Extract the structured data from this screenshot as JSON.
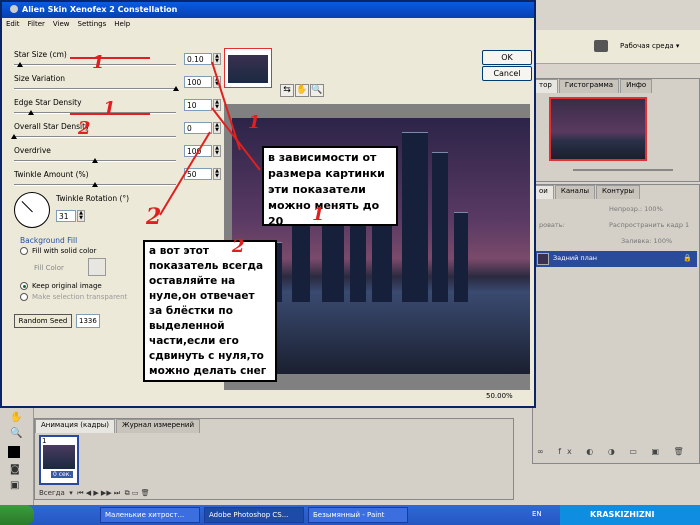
{
  "photoshop": {
    "workspace_label": "Рабочая среда ▾",
    "navigator_tabs": [
      "тор",
      "Гистограмма",
      "Инфо"
    ],
    "layers_tabs": [
      "ои",
      "Каналы",
      "Контуры"
    ],
    "layers_opacity_label": "Непрозр.:",
    "layers_opacity_value": "100%",
    "layers_propagate_label": "Распространить кадр 1",
    "layers_fill_label": "Заливка:",
    "layers_fill_value": "100%",
    "layers_mode_label": "ровать:",
    "layer_name": "Задний план",
    "anim_tabs": [
      "Анимация (кадры)",
      "Журнал измерений"
    ],
    "frame_number": "1",
    "frame_time": "0 сек.",
    "loop_label": "Всегда"
  },
  "dialog": {
    "title": "Alien Skin Xenofex 2 Constellation",
    "menu": [
      "Edit",
      "Filter",
      "View",
      "Settings",
      "Help"
    ],
    "params": [
      {
        "label": "Star Size (cm)",
        "value": "0.10",
        "level": 0.02
      },
      {
        "label": "Size Variation",
        "value": "100",
        "level": 1.0
      },
      {
        "label": "Edge Star Density",
        "value": "10",
        "level": 0.1
      },
      {
        "label": "Overall Star Density",
        "value": "0",
        "level": 0.0
      },
      {
        "label": "Overdrive",
        "value": "100",
        "level": 0.5
      },
      {
        "label": "Twinkle Amount (%)",
        "value": "50",
        "level": 0.5
      }
    ],
    "twinkle_rotation_label": "Twinkle Rotation (°)",
    "twinkle_rotation_value": "31",
    "bg_fill_title": "Background Fill",
    "fill_solid_label": "Fill with solid color",
    "fill_color_label": "Fill Color",
    "keep_original_label": "Keep original image",
    "make_transparent_label": "Make selection transparent",
    "random_seed_label": "Random Seed",
    "random_seed_value": "1336",
    "ok_label": "OK",
    "cancel_label": "Cancel",
    "zoom_label": "50.00%"
  },
  "notes": {
    "note1": "в зависимости от размера картинки эти показатели можно менять до 20",
    "note2": "а вот этот показатель всегда оставляйте на нуле,он отвечает за блёстки по выделенной части,если его сдвинуть с нуля,то можно делать снег",
    "marks": [
      "1",
      "1",
      "1",
      "1",
      "2",
      "2",
      "2"
    ]
  },
  "taskbar": {
    "tasks": [
      "Маленькие хитрост...",
      "Adobe Photoshop CS...",
      "Безымянный - Paint"
    ],
    "lang": "EN",
    "watermark": "KRASKIZHIZNI"
  },
  "colors": {
    "accent_red": "#e02020",
    "title_blue": "#0a5ae0",
    "taskbar_blue": "#2457c2"
  }
}
